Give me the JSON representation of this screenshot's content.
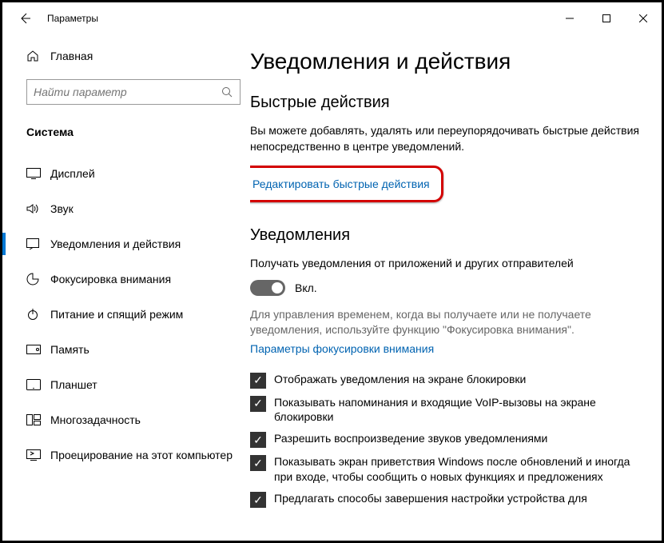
{
  "window": {
    "title": "Параметры"
  },
  "sidebar": {
    "home_label": "Главная",
    "search_placeholder": "Найти параметр",
    "category": "Система",
    "items": [
      {
        "label": "Дисплей"
      },
      {
        "label": "Звук"
      },
      {
        "label": "Уведомления и действия"
      },
      {
        "label": "Фокусировка внимания"
      },
      {
        "label": "Питание и спящий режим"
      },
      {
        "label": "Память"
      },
      {
        "label": "Планшет"
      },
      {
        "label": "Многозадачность"
      },
      {
        "label": "Проецирование на этот компьютер"
      }
    ]
  },
  "main": {
    "page_title": "Уведомления и действия",
    "quick_actions": {
      "header": "Быстрые действия",
      "description": "Вы можете добавлять, удалять или переупорядочивать быстрые действия непосредственно в центре уведомлений.",
      "edit_link": "Редактировать быстрые действия"
    },
    "notifications": {
      "header": "Уведомления",
      "toggle_label": "Получать уведомления от приложений и других отправителей",
      "toggle_state": "Вкл.",
      "focus_hint": "Для управления временем, когда вы получаете или не получаете уведомления, используйте функцию \"Фокусировка внимания\".",
      "focus_link": "Параметры фокусировки внимания",
      "checks": [
        "Отображать уведомления на экране блокировки",
        "Показывать напоминания и входящие VoIP-вызовы на экране блокировки",
        "Разрешить  воспроизведение звуков уведомлениями",
        "Показывать экран приветствия Windows после обновлений и иногда при входе, чтобы сообщить о новых функциях и предложениях",
        "Предлагать способы завершения настройки устройства для"
      ]
    }
  }
}
